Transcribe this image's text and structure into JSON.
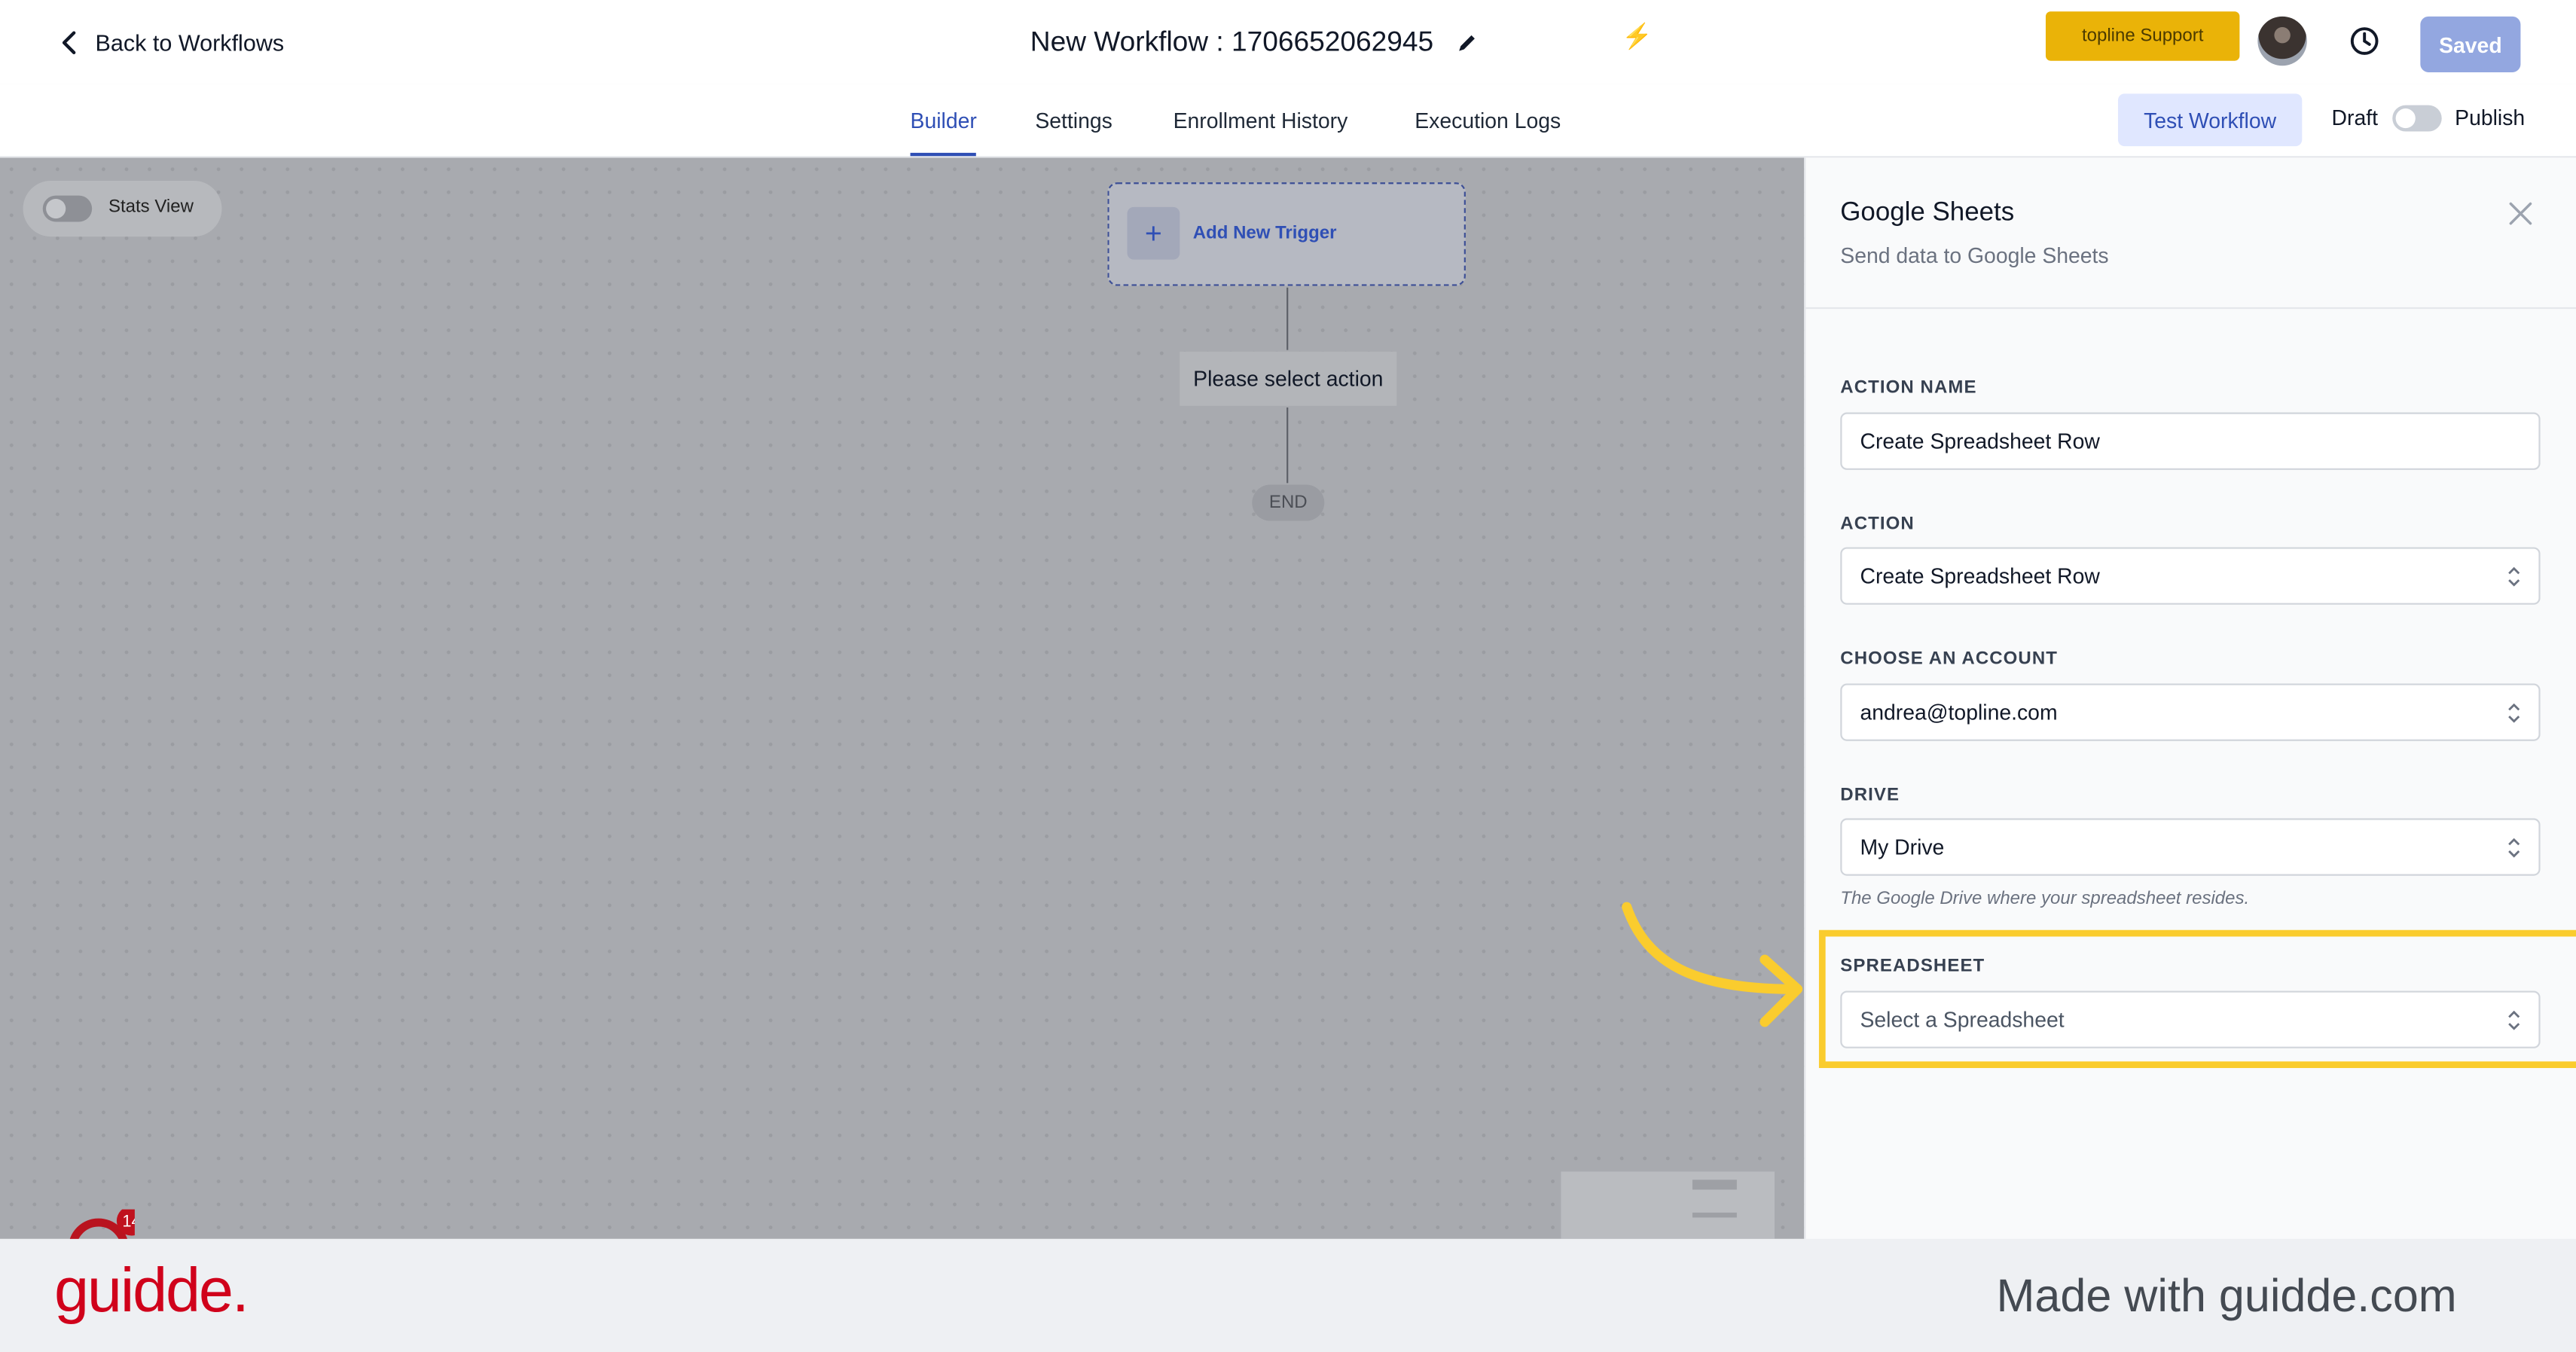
{
  "header": {
    "back_label": "Back to Workflows",
    "title": "New Workflow : 1706652062945",
    "support_label": "topline Support",
    "saved_label": "Saved"
  },
  "tabs": [
    {
      "label": "Builder",
      "active": true
    },
    {
      "label": "Settings",
      "active": false
    },
    {
      "label": "Enrollment History",
      "active": false
    },
    {
      "label": "Execution Logs",
      "active": false
    }
  ],
  "toolbar": {
    "test_label": "Test Workflow",
    "draft_label": "Draft",
    "publish_label": "Publish",
    "publish_enabled": false
  },
  "canvas": {
    "stats_label": "Stats View",
    "stats_enabled": false,
    "trigger_label": "Add New Trigger",
    "action_placeholder": "Please select action",
    "end_label": "END",
    "chat_badge_count": "14"
  },
  "panel": {
    "title": "Google Sheets",
    "subtitle": "Send data to Google Sheets",
    "fields": {
      "action_name": {
        "label": "ACTION NAME",
        "value": "Create Spreadsheet Row"
      },
      "action": {
        "label": "ACTION",
        "value": "Create Spreadsheet Row"
      },
      "account": {
        "label": "CHOOSE AN ACCOUNT",
        "value": "andrea@topline.com"
      },
      "drive": {
        "label": "DRIVE",
        "value": "My Drive",
        "hint": "The Google Drive where your spreadsheet resides."
      },
      "spreadsheet": {
        "label": "SPREADSHEET",
        "placeholder": "Select a Spreadsheet"
      }
    }
  },
  "footer": {
    "brand": "guidde.",
    "made_with": "Made with guidde.com"
  },
  "colors": {
    "accent": "#2f4fb5",
    "highlight": "#facc2e",
    "brand": "#d0021b",
    "support": "#eab308"
  }
}
